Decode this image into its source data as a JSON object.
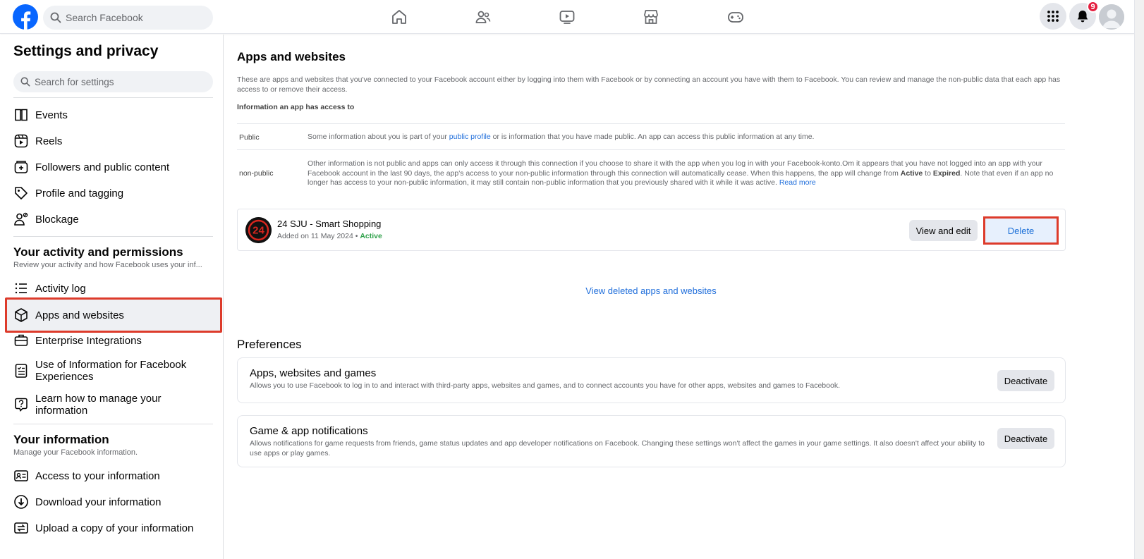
{
  "topbar": {
    "search_placeholder": "Search Facebook",
    "nav_icons": [
      "home-icon",
      "friends-icon",
      "video-icon",
      "marketplace-icon",
      "gaming-icon"
    ],
    "notification_count": "9"
  },
  "sidebar": {
    "title": "Settings and privacy",
    "search_placeholder": "Search for settings",
    "items_top": [
      {
        "label": "Events",
        "icon": "calendar-icon"
      },
      {
        "label": "Reels",
        "icon": "reels-icon"
      },
      {
        "label": "Followers and public content",
        "icon": "followers-icon"
      },
      {
        "label": "Profile and tagging",
        "icon": "tag-icon"
      },
      {
        "label": "Blockage",
        "icon": "block-user-icon"
      }
    ],
    "activity_heading": "Your activity and permissions",
    "activity_sub": "Review your activity and how Facebook uses your inf...",
    "items_activity": [
      {
        "label": "Activity log",
        "icon": "list-icon"
      },
      {
        "label": "Apps and websites",
        "icon": "cube-icon",
        "selected": true
      },
      {
        "label": "Enterprise Integrations",
        "icon": "briefcase-icon"
      },
      {
        "label": "Use of Information for Facebook Experiences",
        "icon": "document-icon"
      },
      {
        "label": "Learn how to manage your information",
        "icon": "help-bubble-icon"
      }
    ],
    "info_heading": "Your information",
    "info_sub": "Manage your Facebook information.",
    "items_info": [
      {
        "label": "Access to your information",
        "icon": "id-card-icon"
      },
      {
        "label": "Download your information",
        "icon": "download-icon"
      },
      {
        "label": "Upload a copy of your information",
        "icon": "transfer-icon"
      }
    ]
  },
  "main": {
    "title": "Apps and websites",
    "intro": "These are apps and websites that you've connected to your Facebook account either by logging into them with Facebook or by connecting an account you have with them to Facebook. You can review and manage the non-public data that each app has access to or remove their access.",
    "info_heading": "Information an app has access to",
    "public": {
      "label": "Public",
      "text_before": "Some information about you is part of your ",
      "link": "public profile",
      "text_after": " or is information that you have made public. An app can access this public information at any time."
    },
    "nonpublic": {
      "label": "non-public",
      "text_1": "Other information is not public and apps can only access it through this connection if you choose to share it with the app when you log in with your Facebook-konto.Om it appears that you have not logged into an app with your Facebook account in the last 90 days, the app's access to your non-public information through this connection will automatically cease. When this happens, the app will change from ",
      "active_word": "Active",
      "text_2": " to ",
      "expired_word": "Expired",
      "text_3": ". Note that even if an app no longer has access to your non-public information, it may still contain non-public information that you previously shared with it while it was active. ",
      "read_more": "Read more"
    },
    "app": {
      "logo_text": "24",
      "name": "24 SJU - Smart Shopping",
      "added": "Added on 11 May 2024",
      "separator": "•",
      "status": "Active",
      "view_edit_label": "View and edit",
      "delete_label": "Delete"
    },
    "view_deleted": "View deleted apps and websites",
    "preferences_heading": "Preferences",
    "prefs": [
      {
        "title": "Apps, websites and games",
        "desc": "Allows you to use Facebook to log in to and interact with third-party apps, websites and games, and to connect accounts you have for other apps, websites and games to Facebook.",
        "button": "Deactivate"
      },
      {
        "title": "Game & app notifications",
        "desc": "Allows notifications for game requests from friends, game status updates and app developer notifications on Facebook. Changing these settings won't affect the games in your game settings. It also doesn't affect your ability to use apps or play games.",
        "button": "Deactivate"
      }
    ]
  },
  "colors": {
    "facebook_blue": "#0866ff",
    "link_blue": "#216fdb",
    "highlight_red": "#dd3b2b",
    "active_green": "#31a24c",
    "badge_red": "#e41e3f"
  }
}
